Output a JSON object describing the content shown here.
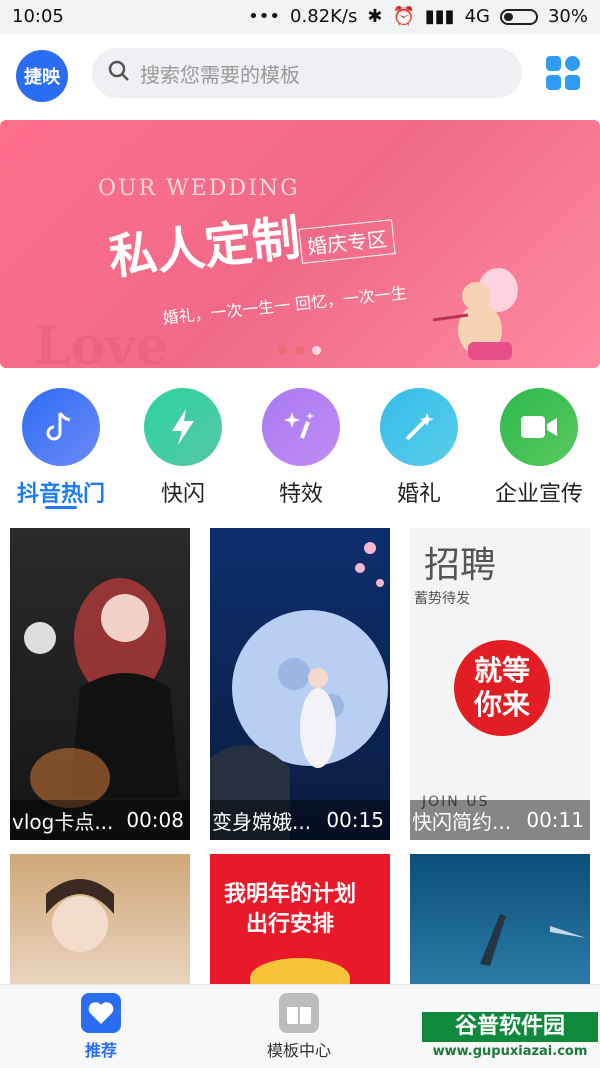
{
  "status_bar": {
    "time": "10:05",
    "network_speed": "0.82K/s",
    "network_type": "4G",
    "battery": "30%",
    "battery_level": 0.3
  },
  "header": {
    "logo_text": "捷映",
    "search_placeholder": "搜索您需要的模板"
  },
  "banner": {
    "subtitle": "OUR WEDDING",
    "title": "私人定制",
    "tag": "婚庆专区",
    "tagline": "婚礼，一次一生一 回忆，一次一生",
    "love_text": "Love",
    "slides_count": 3,
    "active_slide": 3
  },
  "categories": [
    {
      "label": "抖音热门",
      "icon": "tiktok-icon",
      "color": "#3b6ff5",
      "active": true
    },
    {
      "label": "快闪",
      "icon": "lightning-icon",
      "color": "#38c9a0",
      "active": false
    },
    {
      "label": "特效",
      "icon": "sparkle-icon",
      "color": "#b37ff0",
      "active": false
    },
    {
      "label": "婚礼",
      "icon": "magic-wand-icon",
      "color": "#45c4e8",
      "active": false
    },
    {
      "label": "企业宣传",
      "icon": "video-camera-icon",
      "color": "#3fbf5a",
      "active": false
    }
  ],
  "cards": [
    {
      "name": "vlog卡点...",
      "duration": "00:08",
      "image_desc": "gothic portrait"
    },
    {
      "name": "变身嫦娥...",
      "duration": "00:15",
      "image_desc": "moon goddess"
    },
    {
      "name": "快闪简约...",
      "duration": "00:11",
      "image_desc": "recruitment poster"
    }
  ],
  "card_row2": {
    "middle_text_line1": "我明年的计划",
    "middle_text_line2": "出行安排"
  },
  "poster_texts": {
    "zhaopin": "招聘",
    "deng_ni_lai": "就等你来",
    "xushi": "蓄势待发",
    "join": "JOIN US"
  },
  "bottom_nav": [
    {
      "label": "推荐",
      "icon": "heart-icon",
      "active": true
    },
    {
      "label": "模板中心",
      "icon": "template-icon",
      "active": false
    }
  ],
  "watermark": {
    "line1": "谷普软件园",
    "line2": "www.gupuxiazai.com"
  }
}
